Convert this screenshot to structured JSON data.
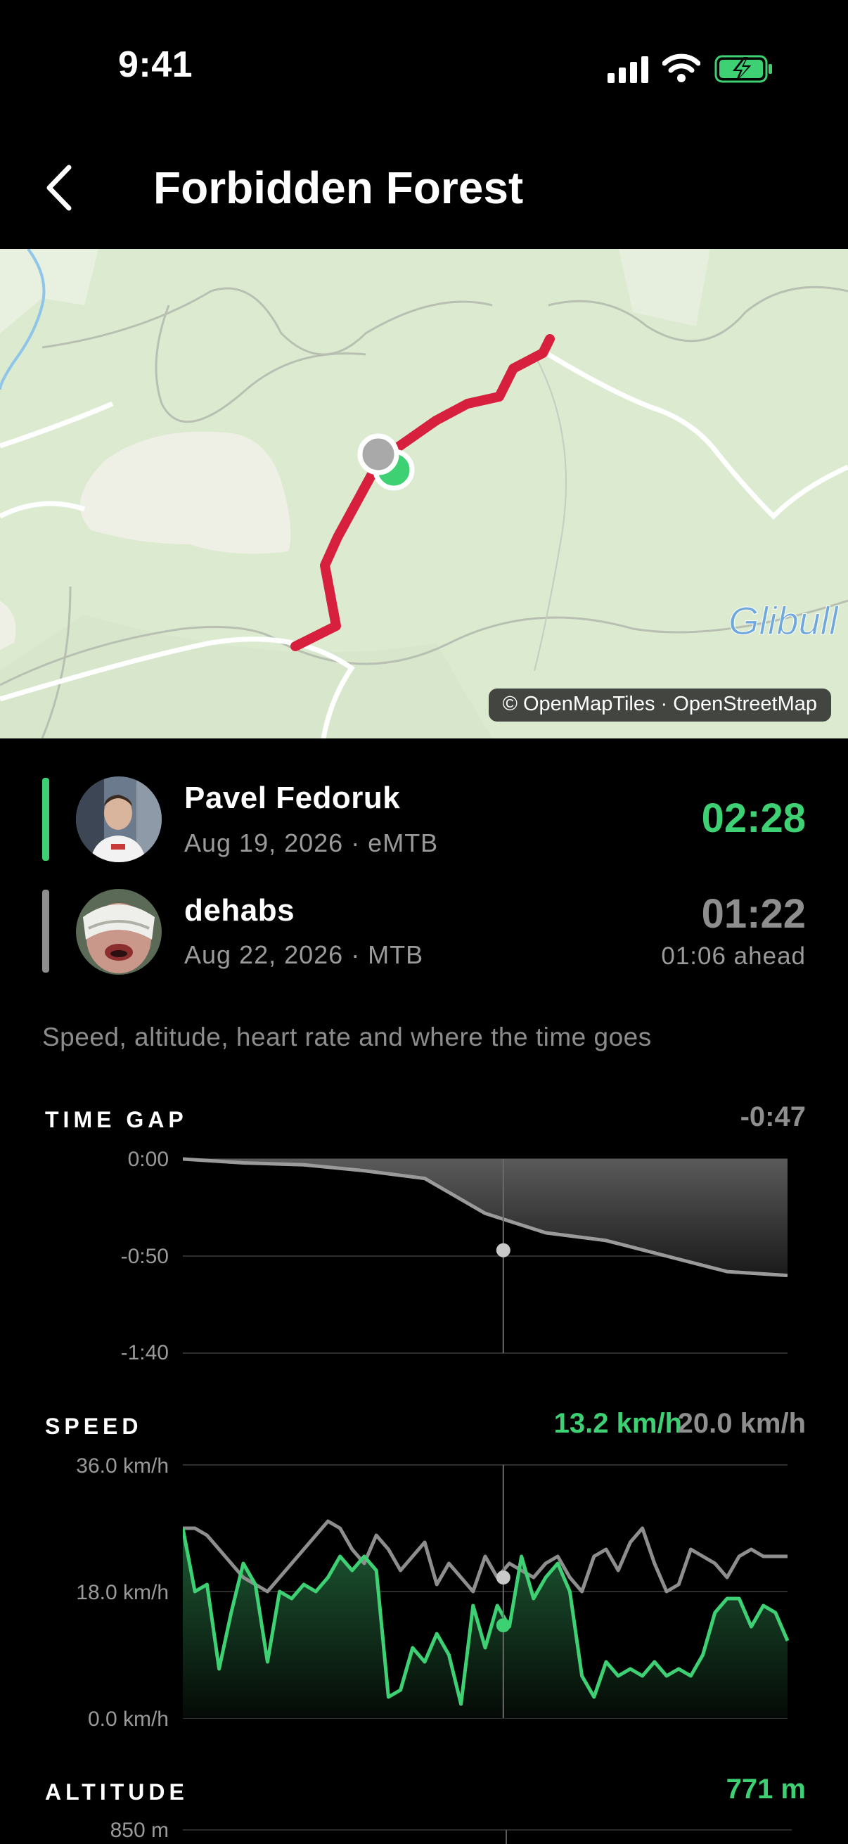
{
  "status_bar": {
    "time": "9:41"
  },
  "header": {
    "title": "Forbidden Forest"
  },
  "map": {
    "attribution": "© OpenMapTiles · OpenStreetMap",
    "place_label": "Glibull",
    "route_color": "#d71f3e"
  },
  "riders": [
    {
      "name": "Pavel Fedoruk",
      "meta": "Aug 19, 2026 · eMTB",
      "time": "02:28",
      "color": "#3ed174"
    },
    {
      "name": "dehabs",
      "meta": "Aug 22, 2026 · MTB",
      "time": "01:22",
      "ahead": "01:06 ahead",
      "color": "#8e8e8e"
    }
  ],
  "subtitle": "Speed, altitude, heart rate and where the time goes",
  "sections": {
    "time_gap": {
      "label": "TIME GAP",
      "value": "-0:47"
    },
    "speed": {
      "label": "SPEED",
      "value_a": "13.2 km/h",
      "value_b": "20.0 km/h"
    },
    "altitude": {
      "label": "ALTITUDE",
      "value": "771 m",
      "top_tick": "850 m"
    }
  },
  "chart_data": [
    {
      "type": "area",
      "title": "TIME GAP",
      "y_tick_labels": [
        "0:00",
        "-0:50",
        "-1:40"
      ],
      "ylim": [
        -100,
        0
      ],
      "x": [
        0,
        10,
        20,
        30,
        40,
        50,
        60,
        70,
        80,
        90,
        100
      ],
      "series": [
        {
          "values": [
            0,
            -2,
            -3,
            -6,
            -10,
            -28,
            -38,
            -42,
            -50,
            -58,
            -60
          ]
        }
      ],
      "cursor_x": 53,
      "cursor_value": -47
    },
    {
      "type": "line",
      "title": "SPEED",
      "y_tick_labels": [
        "36.0 km/h",
        "18.0 km/h",
        "0.0 km/h"
      ],
      "ylim": [
        0,
        36
      ],
      "x": [
        0,
        2,
        4,
        6,
        8,
        10,
        12,
        14,
        16,
        18,
        20,
        22,
        24,
        26,
        28,
        30,
        32,
        34,
        36,
        38,
        40,
        42,
        44,
        46,
        48,
        50,
        52,
        54,
        56,
        58,
        60,
        62,
        64,
        66,
        68,
        70,
        72,
        74,
        76,
        78,
        80,
        82,
        84,
        86,
        88,
        90,
        92,
        94,
        96,
        98,
        100
      ],
      "series": [
        {
          "color": "#3ed174",
          "values": [
            27,
            18,
            19,
            7,
            15,
            22,
            19,
            8,
            18,
            17,
            19,
            18,
            20,
            23,
            21,
            23,
            21,
            3,
            4,
            10,
            8,
            12,
            9,
            2,
            16,
            10,
            16,
            13,
            23,
            17,
            20,
            22,
            18,
            6,
            3,
            8,
            6,
            7,
            6,
            8,
            6,
            7,
            6,
            9,
            15,
            17,
            17,
            13,
            16,
            15,
            11
          ]
        },
        {
          "color": "#8e8e8e",
          "values": [
            27,
            27,
            26,
            24,
            22,
            20,
            19,
            18,
            20,
            22,
            24,
            26,
            28,
            27,
            24,
            22,
            26,
            24,
            21,
            23,
            25,
            19,
            22,
            20,
            18,
            23,
            20,
            22,
            21,
            20,
            22,
            23,
            20,
            18,
            23,
            24,
            21,
            25,
            27,
            22,
            18,
            19,
            24,
            23,
            22,
            20,
            23,
            24,
            23,
            23,
            23
          ]
        }
      ],
      "cursor_x": 53,
      "cursor_values": [
        13.2,
        20.0
      ]
    }
  ]
}
